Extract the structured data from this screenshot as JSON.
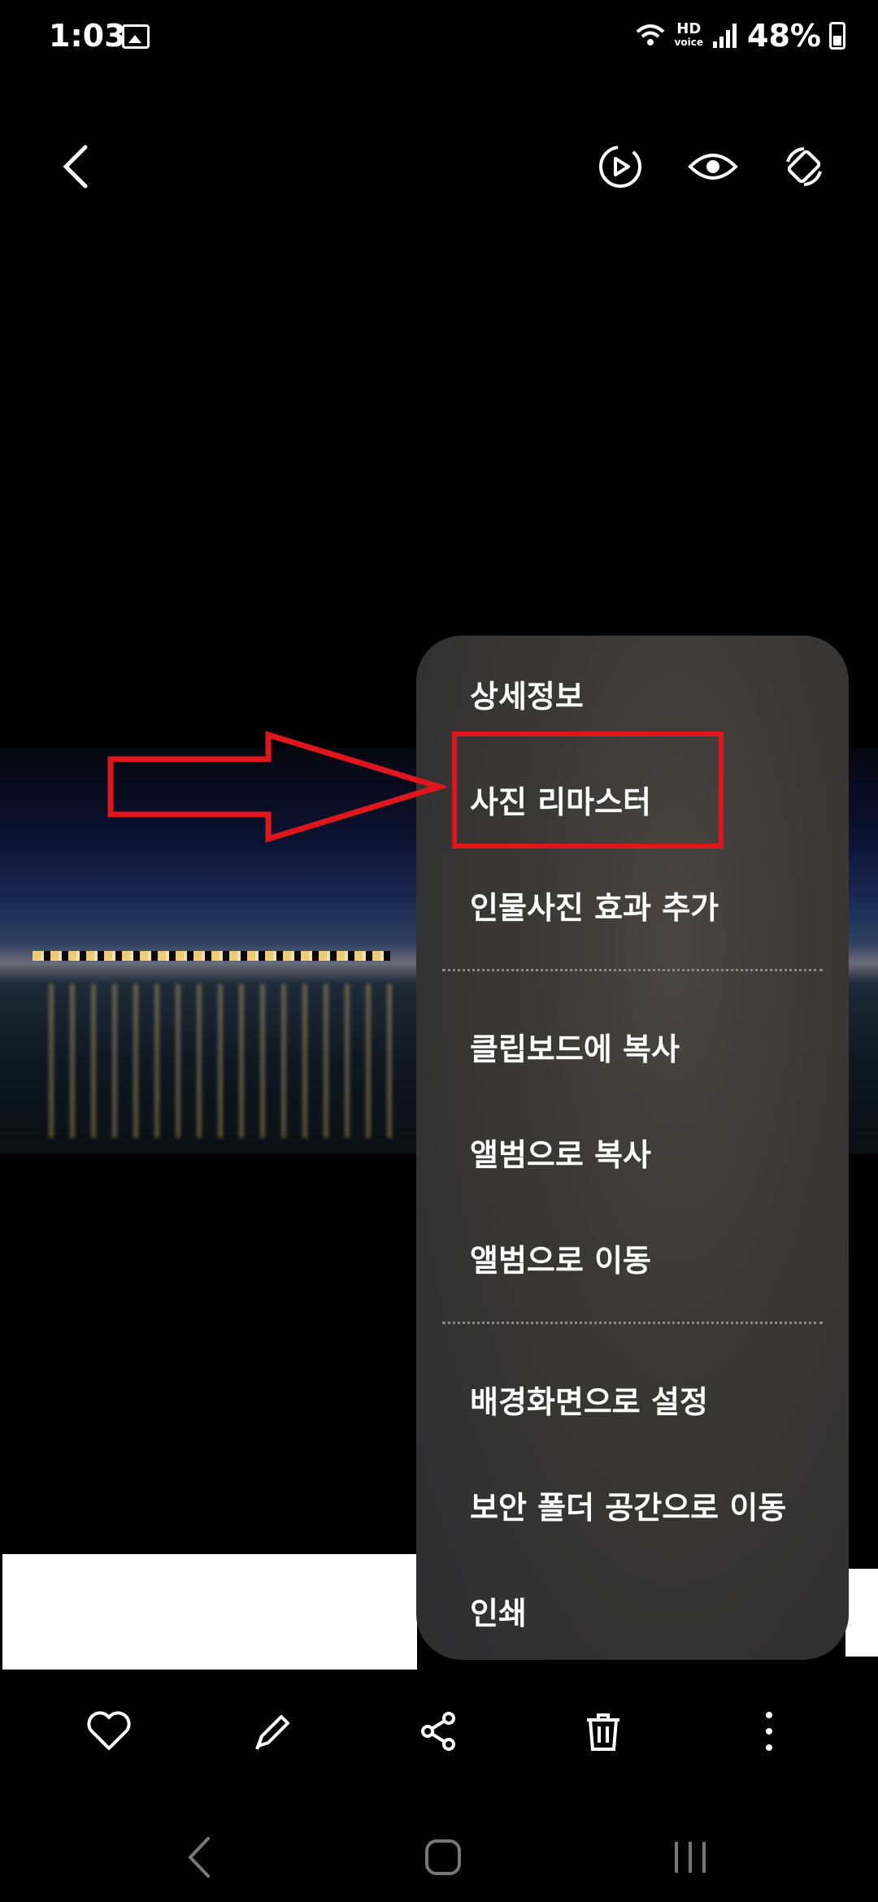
{
  "status_bar": {
    "time": "1:03",
    "hd_line1": "HD",
    "hd_line2": "voice",
    "battery_percent": "48%"
  },
  "toolbar": {
    "icons": [
      "back-icon",
      "video-play-icon",
      "eye-icon",
      "rotate-icon"
    ]
  },
  "menu": {
    "items": [
      "상세정보",
      "사진 리마스터",
      "인물사진 효과 추가",
      "클립보드에 복사",
      "앨범으로 복사",
      "앨범으로 이동",
      "배경화면으로 설정",
      "보안 폴더 공간으로 이동",
      "인쇄"
    ],
    "highlighted_item": "사진 리마스터"
  },
  "action_bar": {
    "icons": [
      "heart-icon",
      "pencil-icon",
      "share-icon",
      "trash-icon",
      "more-vertical-icon"
    ]
  },
  "nav_bar": {
    "icons": [
      "nav-back-icon",
      "nav-home-icon",
      "nav-recents-icon"
    ]
  },
  "colors": {
    "highlight": "#e0161c",
    "menu_bg": "#3a3836"
  }
}
